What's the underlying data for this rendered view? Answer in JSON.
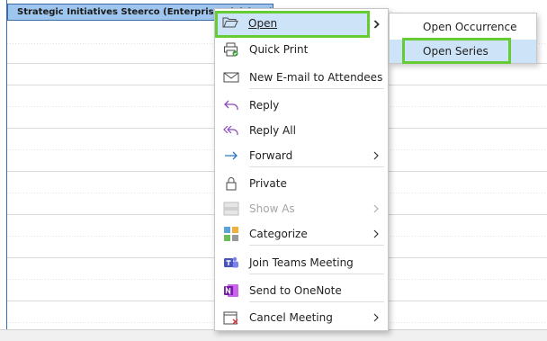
{
  "appointment": {
    "title": "Strategic Initiatives Steerco (Enterprise Divisions) - M"
  },
  "context_menu": {
    "items": [
      {
        "label": "Open",
        "icon": "folder-open-icon",
        "submenu": true
      },
      {
        "label": "Quick Print",
        "icon": "printer-icon"
      },
      {
        "label": "New E-mail to Attendees",
        "icon": "envelope-icon"
      },
      {
        "label": "Reply",
        "icon": "reply-icon"
      },
      {
        "label": "Reply All",
        "icon": "reply-all-icon"
      },
      {
        "label": "Forward",
        "icon": "forward-arrow-icon",
        "submenu": true
      },
      {
        "label": "Private",
        "icon": "lock-icon"
      },
      {
        "label": "Show As",
        "icon": "show-as-icon",
        "submenu": true,
        "disabled": true
      },
      {
        "label": "Categorize",
        "icon": "category-grid-icon",
        "submenu": true
      },
      {
        "label": "Join Teams Meeting",
        "icon": "teams-icon"
      },
      {
        "label": "Send to OneNote",
        "icon": "onenote-icon"
      },
      {
        "label": "Cancel Meeting",
        "icon": "cancel-calendar-icon",
        "submenu": true
      }
    ]
  },
  "submenu": {
    "items": [
      {
        "label": "Open Occurrence"
      },
      {
        "label": "Open Series",
        "active": true
      }
    ]
  },
  "colors": {
    "highlight_border": "#66cc33",
    "hover_bg": "#cde3f7",
    "appointment_bg": "#9fc6ee"
  }
}
